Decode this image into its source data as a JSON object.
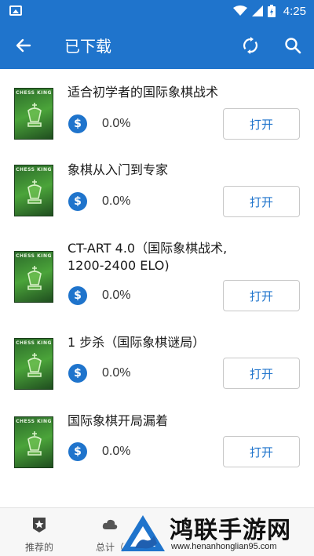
{
  "status_bar": {
    "time": "4:25",
    "icons": [
      "image-icon",
      "wifi-icon",
      "signal-icon",
      "battery-charging-icon"
    ]
  },
  "app_bar": {
    "title": "已下载",
    "background_color": "#1f74cc",
    "back_icon": "arrow-left-icon",
    "sync_icon": "sync-icon",
    "search_icon": "search-icon"
  },
  "items": [
    {
      "title": "适合初学者的国际象棋战术",
      "progress": "0.0%",
      "button_label": "打开",
      "cover_text": "CHESS KING"
    },
    {
      "title": "象棋从入门到专家",
      "progress": "0.0%",
      "button_label": "打开",
      "cover_text": "CHESS KING"
    },
    {
      "title_line1": "CT-ART 4.0（国际象棋战术,",
      "title_line2": "1200-2400 ELO)",
      "progress": "0.0%",
      "button_label": "打开",
      "cover_text": "CHESS KING"
    },
    {
      "title": "1 步杀（国际象棋谜局）",
      "progress": "0.0%",
      "button_label": "打开",
      "cover_text": "CHESS KING"
    },
    {
      "title": "国际象棋开局漏着",
      "progress": "0.0%",
      "button_label": "打开",
      "cover_text": "CHESS KING"
    }
  ],
  "bottom_nav": {
    "items": [
      {
        "label": "推荐的",
        "icon": "star-badge-icon"
      },
      {
        "label": "总计（",
        "icon": "cloud-icon"
      }
    ]
  },
  "watermark": {
    "text": "鸿联手游网",
    "url": "www.henanhonglian95.com"
  }
}
